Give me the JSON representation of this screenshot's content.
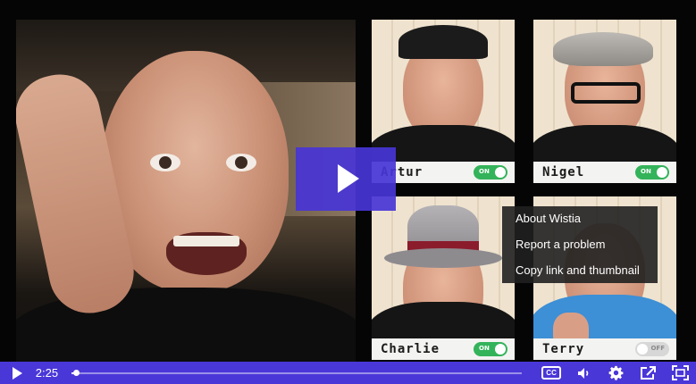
{
  "video": {
    "current_time": "2:25",
    "progress": 0.004
  },
  "tiles": [
    {
      "name": "Artur",
      "toggle": "ON"
    },
    {
      "name": "Nigel",
      "toggle": "ON"
    },
    {
      "name": "Charlie",
      "toggle": "ON"
    },
    {
      "name": "Terry",
      "toggle": "OFF"
    }
  ],
  "context_menu": {
    "items": [
      "About Wistia",
      "Report a problem",
      "Copy link and thumbnail"
    ]
  },
  "colors": {
    "accent": "#4a37d8",
    "toggle_on": "#33b35a",
    "toggle_off": "#d7d7d7"
  },
  "icons": [
    "play-icon",
    "closed-captions-icon",
    "volume-icon",
    "gear-icon",
    "share-icon",
    "fullscreen-icon"
  ]
}
